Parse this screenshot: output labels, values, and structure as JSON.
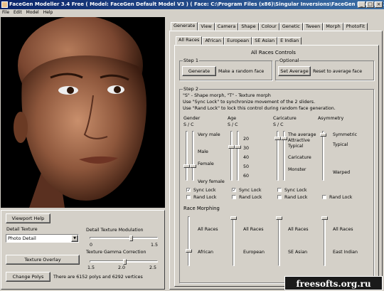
{
  "window": {
    "title": "FaceGen Modeller 3.4 Free   ( Model: FaceGen Default Model V3 )   ( Face: C:\\Program Files (x86)\\Singular Inversions\\FaceGen Modeller 3.4 Free\\Examples\\F..."
  },
  "menu": [
    "File",
    "Edit",
    "Model",
    "Help"
  ],
  "left": {
    "viewport_help": "Viewport Help",
    "detail_texture_label": "Detail Texture",
    "detail_texture_value": "Photo Detail",
    "modulation_label": "Detail Texture Modulation",
    "modulation_ticks": [
      "0",
      "1.5"
    ],
    "modulation_level": 0.62,
    "texture_overlay": "Texture Overlay",
    "gamma_label": "Texture Gamma Correction",
    "gamma_ticks": [
      "1.5",
      "2.0",
      "2.5"
    ],
    "gamma_level": 0.52,
    "change_polys": "Change Polys",
    "poly_info": "There are 6152 polys and 6292 vertices"
  },
  "tabs": [
    "Generate",
    "View",
    "Camera",
    "Shape",
    "Colour",
    "Genetic",
    "Tween",
    "Morph",
    "PhotoFit"
  ],
  "subtabs": [
    "All Races",
    "African",
    "European",
    "SE Asian",
    "E Indian"
  ],
  "controls": {
    "heading": "All Races Controls",
    "step1": "Step 1",
    "generate": "Generate",
    "generate_desc": "Make a random face",
    "optional": "Optional",
    "set_average": "Set Average",
    "average_desc": "Reset to average face",
    "step2": "Step 2",
    "help": [
      "\"S\" - Shape morph, \"T\" - Texture morph",
      "Use \"Sync Lock\" to synchronize movement of the 2 sliders.",
      "Use \"Rand Lock\" to lock this control during random face generation."
    ],
    "gender": {
      "title": "Gender",
      "sc": "S / C",
      "labels": [
        "Very male",
        "Male",
        "Female",
        "Very female"
      ],
      "level": 0.72
    },
    "age": {
      "title": "Age",
      "sc": "S / C",
      "labels": [
        "20",
        "30",
        "40",
        "50",
        "60"
      ],
      "level": 0.3
    },
    "caricature": {
      "title": "Caricature",
      "sc": "S / C",
      "labels": [
        "The average",
        "Attractive",
        "Typical",
        "Caricature",
        "Monster"
      ],
      "level": 0.12
    },
    "asymmetry": {
      "title": "Asymmetry",
      "labels": [
        "Symmetric",
        "Typical",
        "Warped"
      ],
      "level": 0.05
    },
    "sync_lock": "Sync Lock",
    "rand_lock": "Rand Lock",
    "race_morphing": "Race Morphing",
    "races": [
      {
        "top": "All Races",
        "bottom": "African"
      },
      {
        "top": "All Races",
        "bottom": "European"
      },
      {
        "top": "All Races",
        "bottom": "SE Asian"
      },
      {
        "top": "All Races",
        "bottom": "East Indian"
      }
    ]
  },
  "watermark": "freesofts.org.ru"
}
